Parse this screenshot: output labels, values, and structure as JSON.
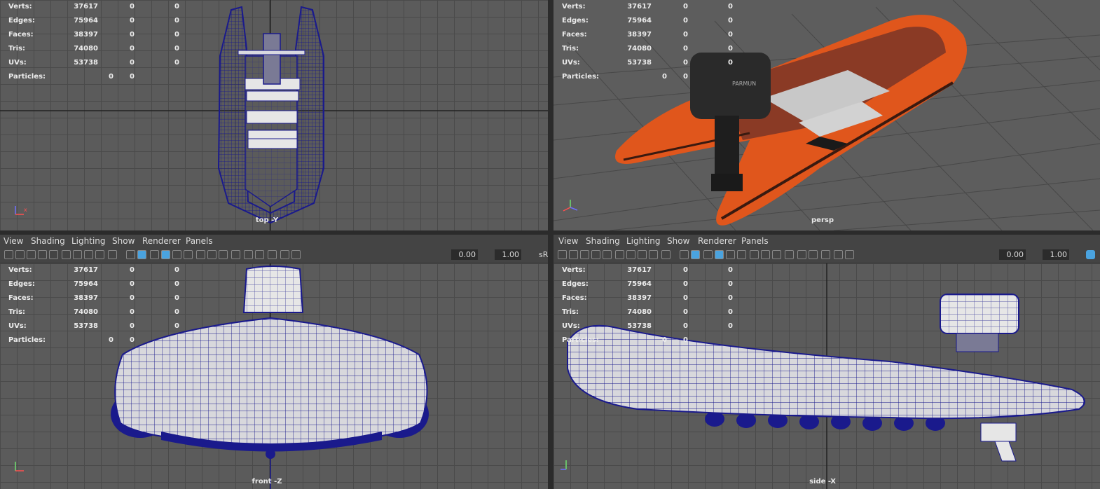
{
  "stats": {
    "verts": {
      "label": "Verts:",
      "v1": "37617",
      "v2": "0",
      "v3": "0"
    },
    "edges": {
      "label": "Edges:",
      "v1": "75964",
      "v2": "0",
      "v3": "0"
    },
    "faces": {
      "label": "Faces:",
      "v1": "38397",
      "v2": "0",
      "v3": "0"
    },
    "tris": {
      "label": "Tris:",
      "v1": "74080",
      "v2": "0",
      "v3": "0"
    },
    "uvs": {
      "label": "UVs:",
      "v1": "53738",
      "v2": "0",
      "v3": "0"
    },
    "particles": {
      "label": "Particles:",
      "v2": "0",
      "v3": "0"
    }
  },
  "viewports": {
    "top": {
      "label": "top -Y"
    },
    "persp": {
      "label": "persp"
    },
    "front": {
      "label": "front -Z"
    },
    "side": {
      "label": "side -X"
    }
  },
  "menu": {
    "view": "View",
    "shading": "Shading",
    "lighting": "Lighting",
    "show": "Show",
    "renderer": "Renderer",
    "panels": "Panels"
  },
  "toolbar": {
    "exposure": "0.00",
    "gamma": "1.00",
    "colorspace": "sR"
  },
  "motor_brand": "PARMUN",
  "colors": {
    "wire": "#1a1a8c",
    "boat": "#e0561c",
    "hull_shade": "#d8d8dc",
    "bg": "#5b5b5b",
    "accent": "#4aa3df"
  },
  "icons": [
    "camera-icon",
    "camera-attrs-icon",
    "bookmark-icon",
    "image-plane-icon",
    "grid-toggle-icon",
    "resolution-gate-icon",
    "gate-mask-icon",
    "field-chart-icon",
    "safe-action-icon",
    "safe-title-icon",
    "wireframe-icon",
    "smooth-shade-icon",
    "default-material-icon",
    "wireframe-on-shaded-icon",
    "textured-icon",
    "use-lights-icon",
    "shadows-icon",
    "ambient-occlusion-icon",
    "motion-blur-icon",
    "anti-alias-icon",
    "depth-of-field-icon",
    "isolate-select-icon",
    "xray-icon",
    "xray-joints-icon",
    "xray-components-icon",
    "exposure-icon",
    "gamma-icon",
    "color-management-icon"
  ]
}
